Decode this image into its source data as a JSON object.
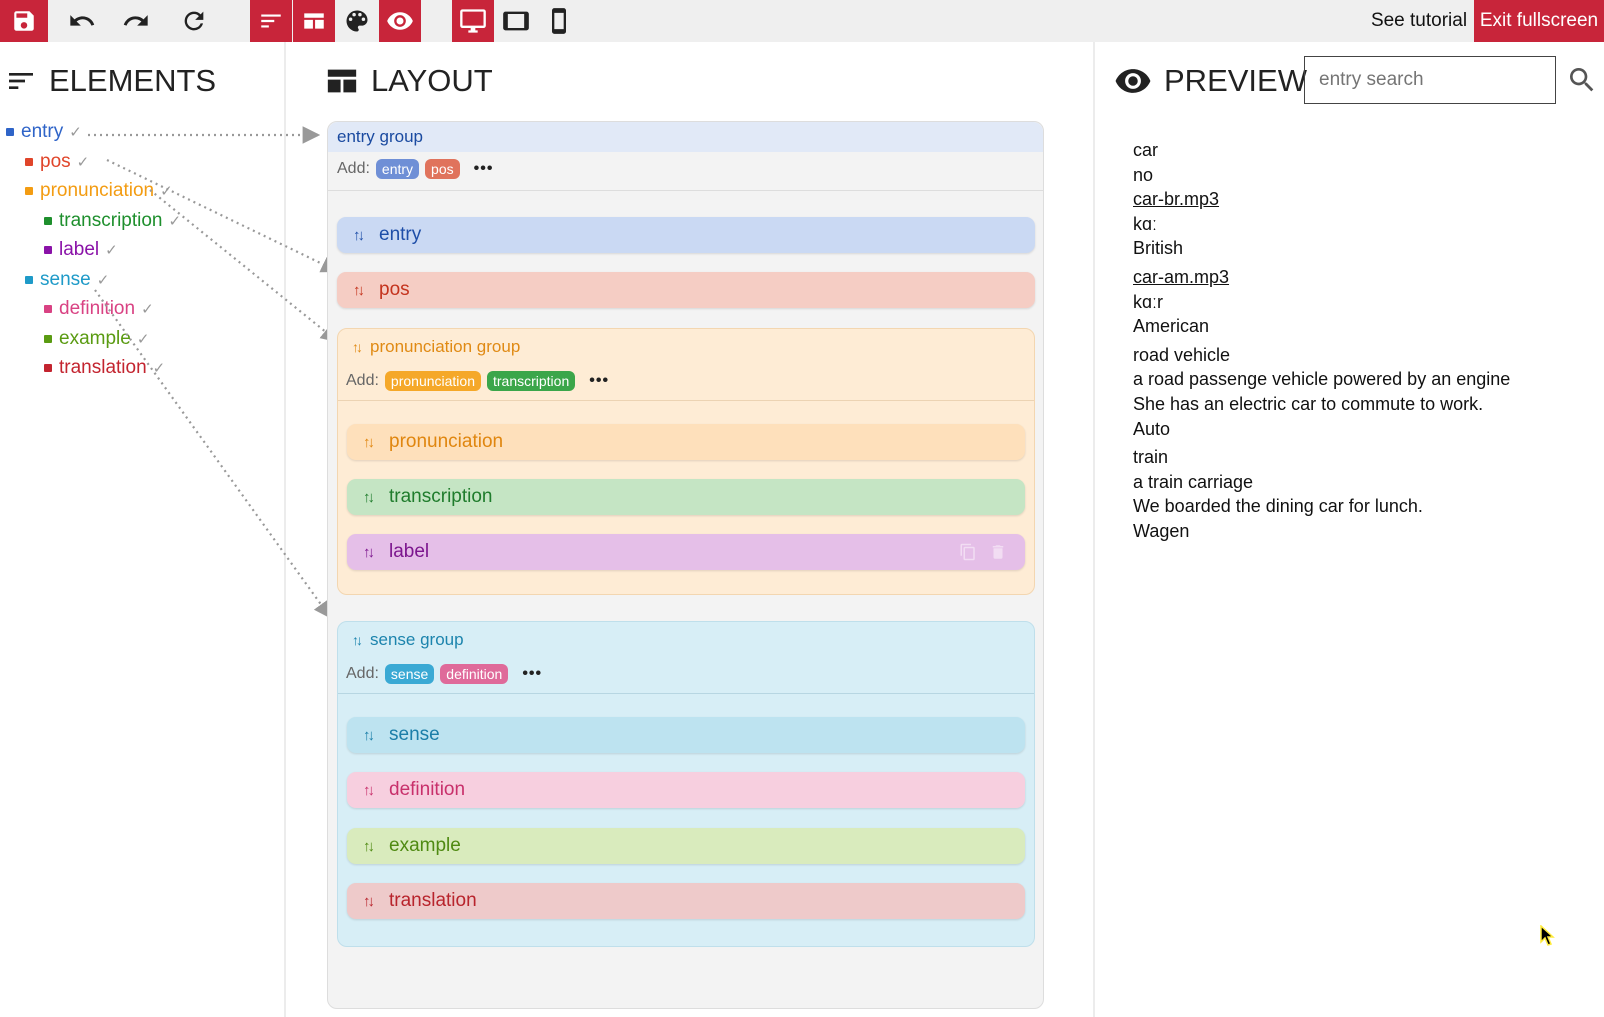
{
  "toolbar": {
    "icons": [
      "save-icon",
      "undo-icon",
      "redo-icon",
      "refresh-icon",
      "elements-view-icon",
      "layout-view-icon",
      "palette-icon",
      "preview-view-icon",
      "desktop-icon",
      "tablet-icon",
      "mobile-icon"
    ],
    "tutorial_label": "See tutorial",
    "exit_label": "Exit fullscreen",
    "accent": "#c8253a"
  },
  "elements_panel": {
    "title": "ELEMENTS",
    "items": [
      {
        "label": "entry",
        "color": "#2f64c8"
      },
      {
        "label": "pos",
        "color": "#e0452a"
      },
      {
        "label": "pronunciation",
        "color": "#f39c12"
      },
      {
        "label": "transcription",
        "color": "#1e8f2d"
      },
      {
        "label": "label",
        "color": "#8a12a8"
      },
      {
        "label": "sense",
        "color": "#1e9ac8"
      },
      {
        "label": "definition",
        "color": "#d94283"
      },
      {
        "label": "example",
        "color": "#5a9b12"
      },
      {
        "label": "translation",
        "color": "#c3242f"
      }
    ]
  },
  "layout_panel": {
    "title": "LAYOUT",
    "entry_group": {
      "title": "entry group",
      "add_label": "Add:",
      "chips": [
        "entry",
        "pos"
      ],
      "elements": [
        "entry",
        "pos"
      ]
    },
    "pronunciation_group": {
      "title": "pronunciation group",
      "add_label": "Add:",
      "chips": [
        "pronunciation",
        "transcription"
      ],
      "elements": [
        "pronunciation",
        "transcription",
        "label"
      ]
    },
    "sense_group": {
      "title": "sense group",
      "add_label": "Add:",
      "chips": [
        "sense",
        "definition"
      ],
      "elements": [
        "sense",
        "definition",
        "example",
        "translation"
      ]
    }
  },
  "preview_panel": {
    "title": "PREVIEW",
    "search_placeholder": "entry search",
    "lines": [
      "car",
      "no",
      "car-br.mp3",
      "kɑː",
      "British",
      "car-am.mp3",
      "kɑːr",
      "American",
      "road vehicle",
      "a road passenge vehicle powered by an engine",
      "She has an electric car to commute to work.",
      "Auto",
      "train",
      "a train carriage",
      "We boarded the dining car for lunch.",
      "Wagen"
    ]
  }
}
